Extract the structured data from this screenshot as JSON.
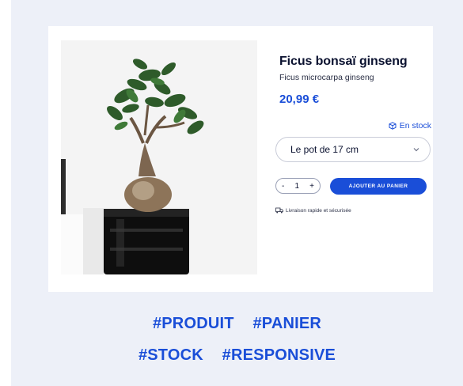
{
  "product": {
    "title": "Ficus bonsaï ginseng",
    "subtitle": "Ficus microcarpa ginseng",
    "price": "20,99 €",
    "stock_label": "En stock",
    "size_select": {
      "value": "Le pot de 17 cm"
    },
    "quantity": {
      "minus": "-",
      "value": "1",
      "plus": "+"
    },
    "add_to_cart_label": "AJOUTER AU PANIER",
    "delivery_note": "Livraison rapide et sécurisée"
  },
  "hashtags": {
    "line1": [
      "#PRODUIT",
      "#PANIER"
    ],
    "line2": [
      "#STOCK",
      "#RESPONSIVE"
    ]
  },
  "colors": {
    "accent": "#1a4ed8",
    "panel_bg": "#edf0f8",
    "title": "#0b1230"
  },
  "icons": {
    "stock": "box-icon",
    "select": "chevron-down-icon",
    "delivery": "truck-icon"
  }
}
